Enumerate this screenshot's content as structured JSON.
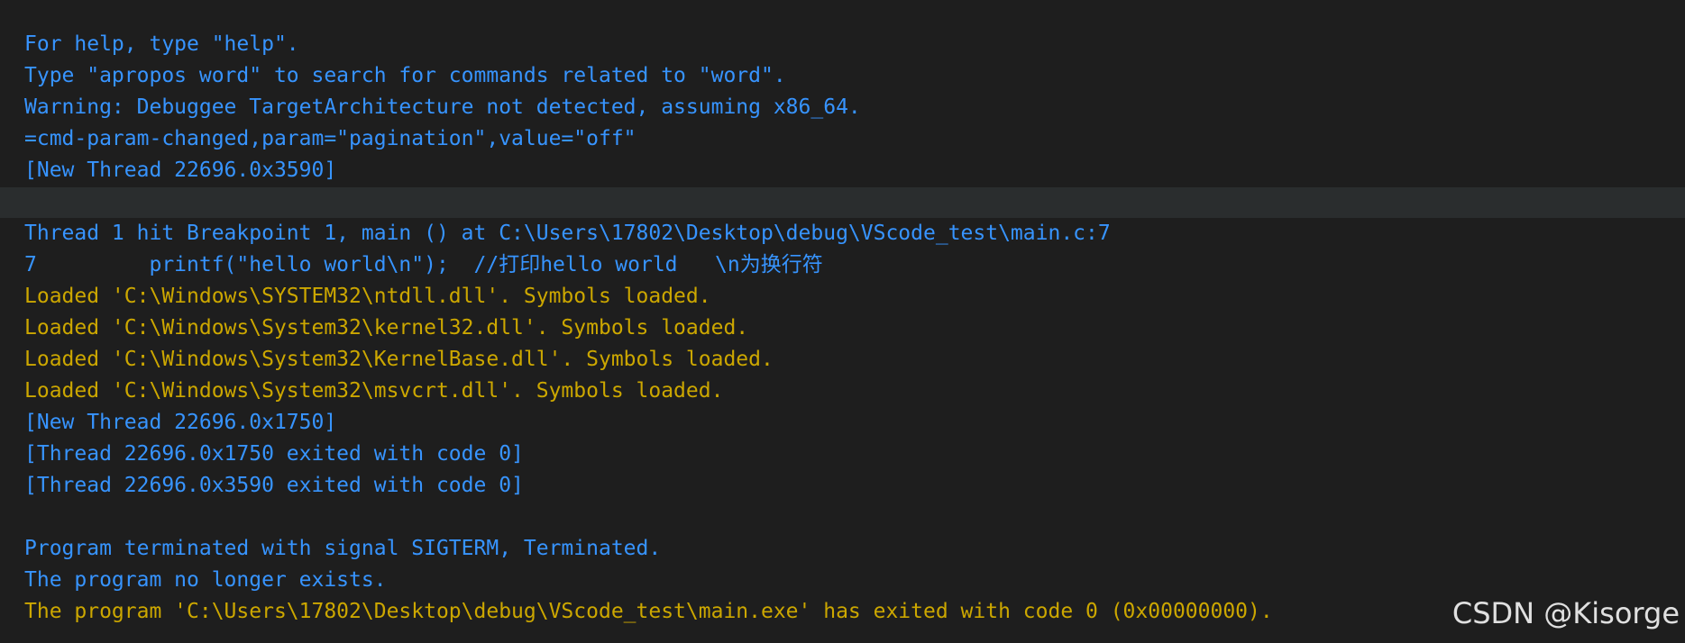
{
  "console": {
    "lines": [
      "For help, type \"help\".",
      "Type \"apropos word\" to search for commands related to \"word\".",
      "Warning: Debuggee TargetArchitecture not detected, assuming x86_64.",
      "=cmd-param-changed,param=\"pagination\",value=\"off\"",
      "[New Thread 22696.0x3590]",
      "",
      "Thread 1 hit Breakpoint 1, main () at C:\\Users\\17802\\Desktop\\debug\\VScode_test\\main.c:7",
      "7         printf(\"hello world\\n\");  //打印hello world   \\n为换行符",
      "Loaded 'C:\\Windows\\SYSTEM32\\ntdll.dll'. Symbols loaded.",
      "Loaded 'C:\\Windows\\System32\\kernel32.dll'. Symbols loaded.",
      "Loaded 'C:\\Windows\\System32\\KernelBase.dll'. Symbols loaded.",
      "Loaded 'C:\\Windows\\System32\\msvcrt.dll'. Symbols loaded.",
      "[New Thread 22696.0x1750]",
      "[Thread 22696.0x1750 exited with code 0]",
      "[Thread 22696.0x3590 exited with code 0]",
      "",
      "Program terminated with signal SIGTERM, Terminated.",
      "The program no longer exists.",
      "The program 'C:\\Users\\17802\\Desktop\\debug\\VScode_test\\main.exe' has exited with code 0 (0x00000000)."
    ]
  },
  "watermark": {
    "text": "CSDN @Kisorge"
  },
  "colors": {
    "background": "#1e1e1e",
    "info_text": "#3794ff",
    "warning_text": "#cca700",
    "highlight_row": "#2a2d2e"
  }
}
